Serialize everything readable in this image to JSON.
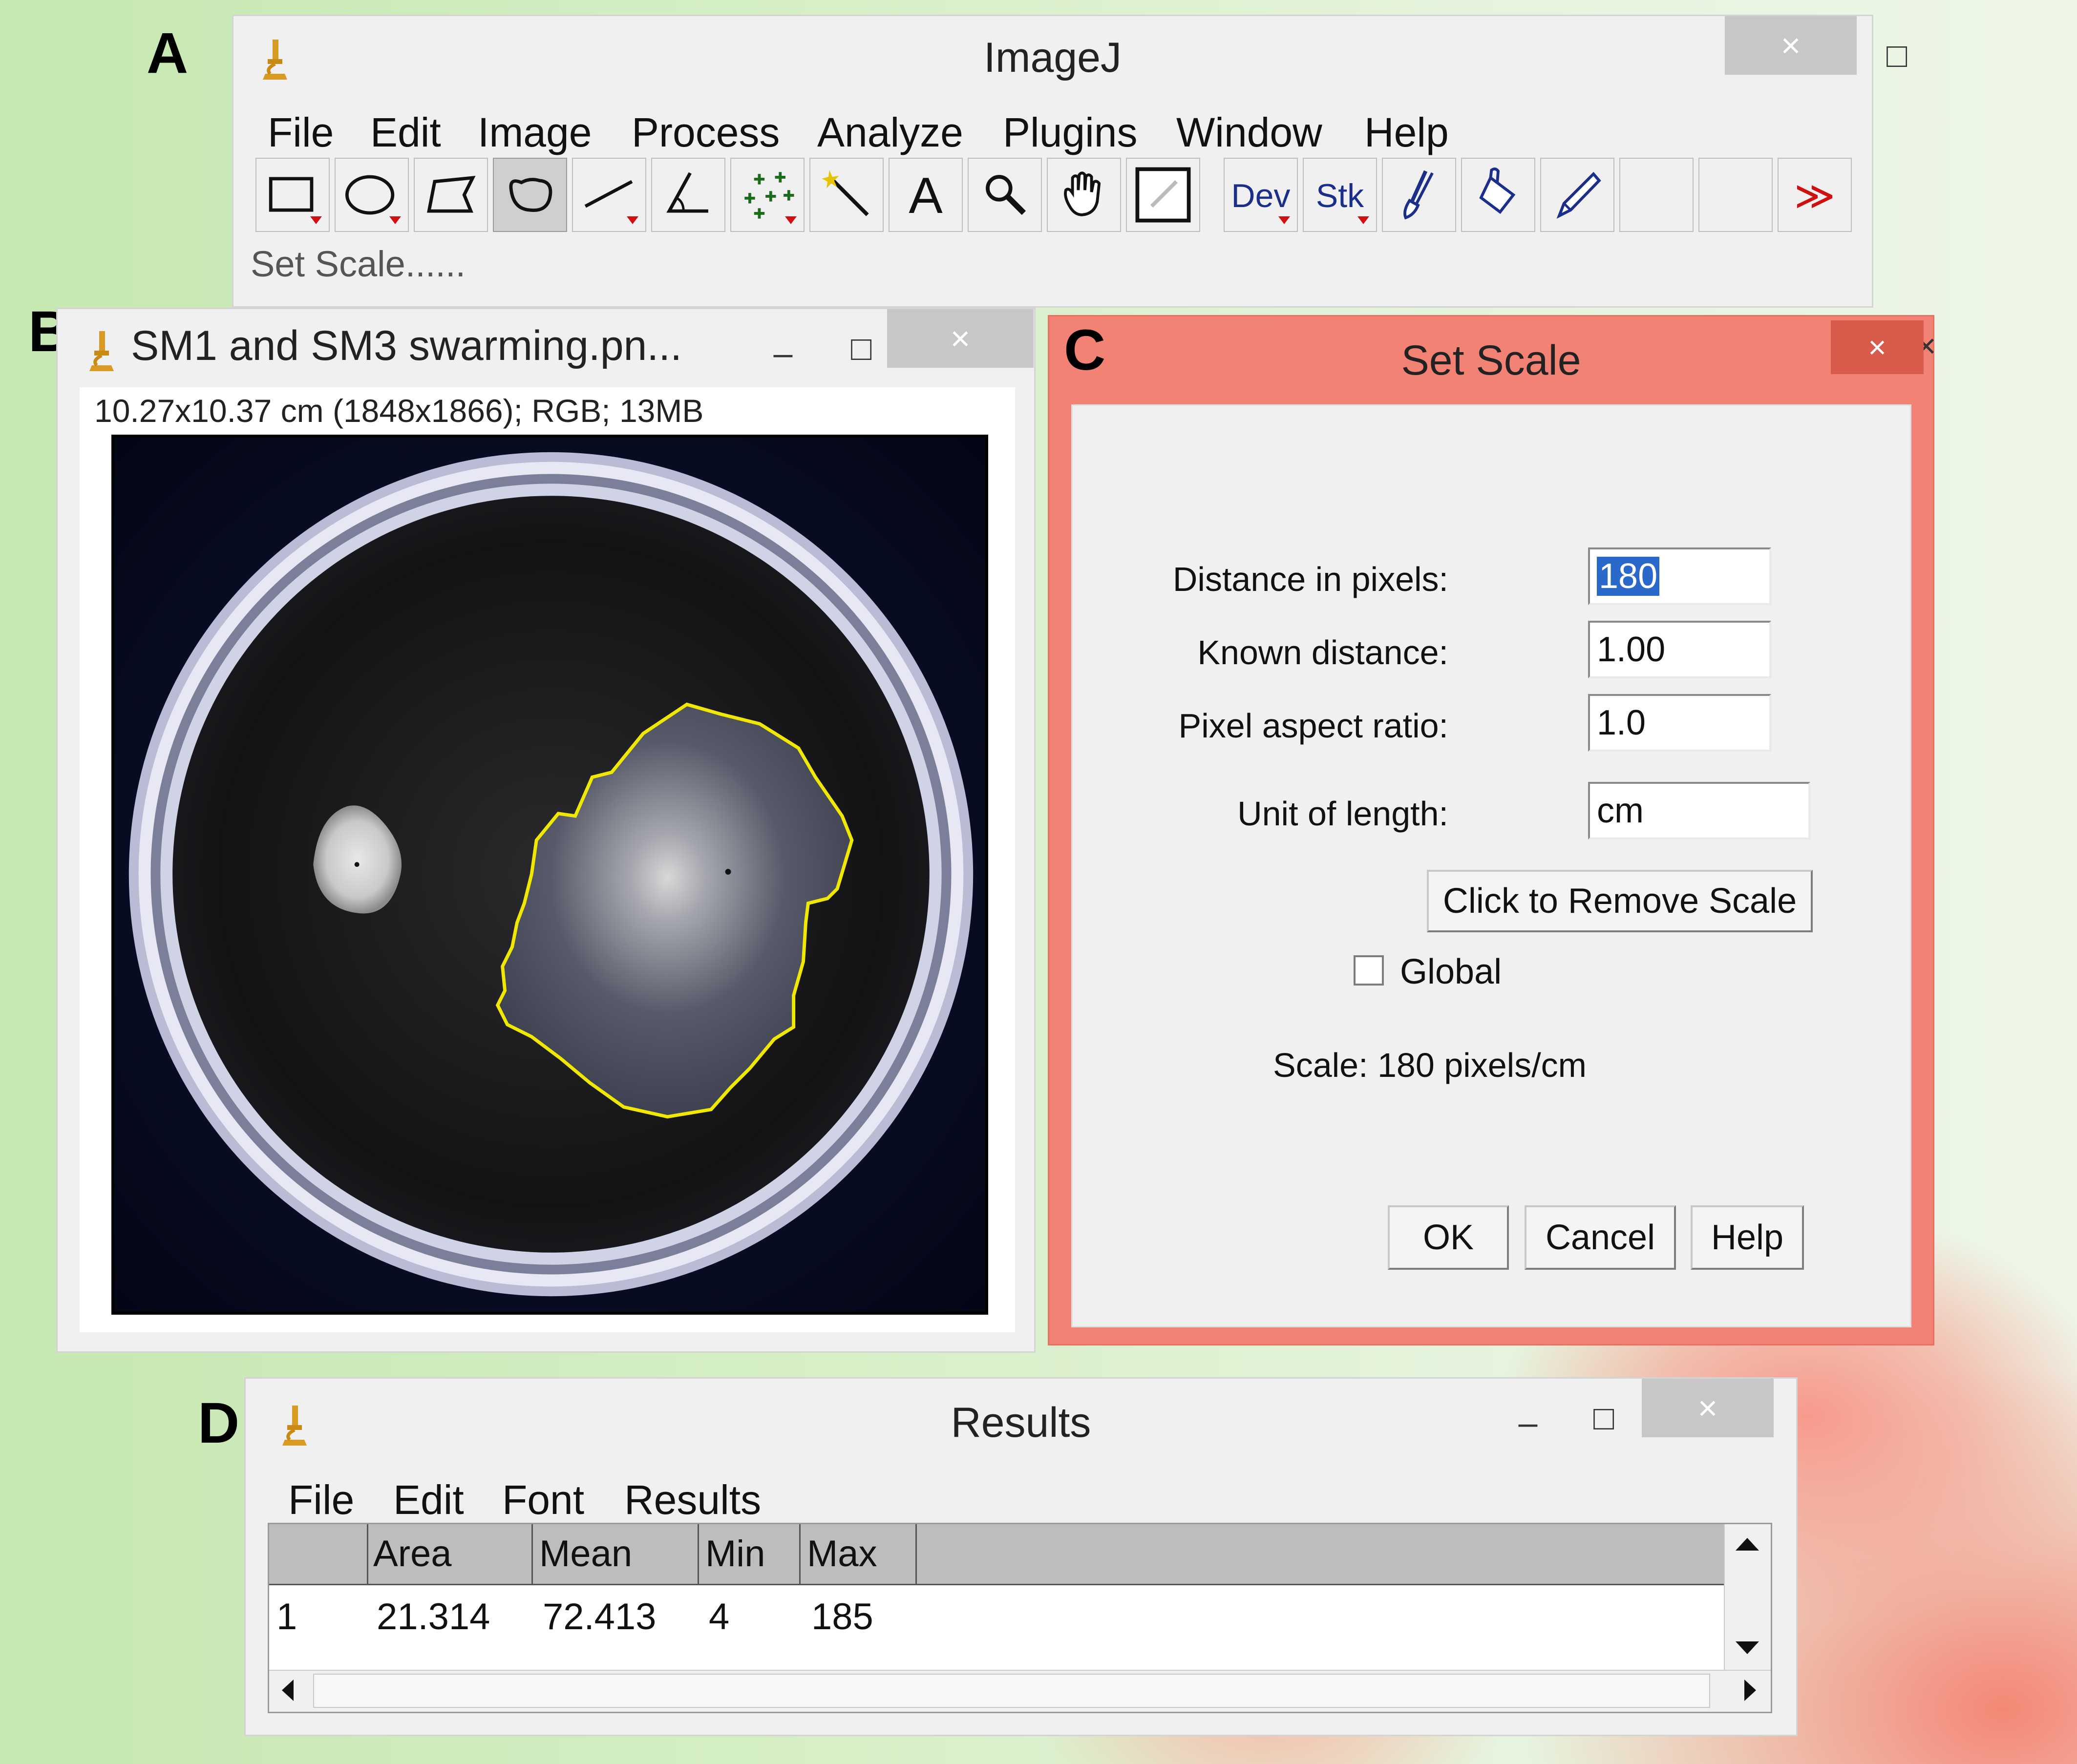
{
  "panels": {
    "a": "A",
    "b": "B",
    "c": "C",
    "d": "D"
  },
  "imagej": {
    "title": "ImageJ",
    "menu": [
      "File",
      "Edit",
      "Image",
      "Process",
      "Analyze",
      "Plugins",
      "Window",
      "Help"
    ],
    "tools": [
      "rectangle-tool",
      "oval-tool",
      "polygon-tool",
      "freehand-tool",
      "line-tool",
      "angle-tool",
      "multipoint-tool",
      "wand-tool",
      "text-tool",
      "magnifier-tool",
      "hand-tool",
      "color-picker-tool",
      "dev-tool",
      "stk-tool",
      "brush-tool",
      "flood-fill-tool",
      "pencil-tool",
      "empty-tool-1",
      "empty-tool-2",
      "more-tools"
    ],
    "tool_dev": "Dev",
    "tool_stk": "Stk",
    "tool_text": "A",
    "more": "≫",
    "status": "Set Scale......"
  },
  "image_window": {
    "title": "SM1 and SM3 swarming.pn...",
    "info": "10.27x10.37 cm (1848x1866); RGB; 13MB"
  },
  "set_scale": {
    "title": "Set Scale",
    "fields": [
      {
        "label": "Distance in pixels:",
        "value": "180"
      },
      {
        "label": "Known distance:",
        "value": "1.00"
      },
      {
        "label": "Pixel aspect ratio:",
        "value": "1.0"
      },
      {
        "label": "Unit of length:",
        "value": "cm"
      }
    ],
    "remove_button": "Click to Remove Scale",
    "global_label": "Global",
    "global_checked": false,
    "scale_text": "Scale: 180 pixels/cm",
    "ok": "OK",
    "cancel": "Cancel",
    "help": "Help"
  },
  "results": {
    "title": "Results",
    "menu": [
      "File",
      "Edit",
      "Font",
      "Results"
    ],
    "columns": [
      "",
      "Area",
      "Mean",
      "Min",
      "Max"
    ],
    "rows": [
      [
        "1",
        "21.314",
        "72.413",
        "4",
        "185"
      ]
    ]
  },
  "window_controls": {
    "minimize": "–",
    "maximize": "□",
    "close": "×"
  },
  "colors": {
    "dialog_accent": "#f28274",
    "roi_outline": "#f0e800",
    "tool_blue": "#1b2f8a",
    "more_red": "#d01010"
  }
}
